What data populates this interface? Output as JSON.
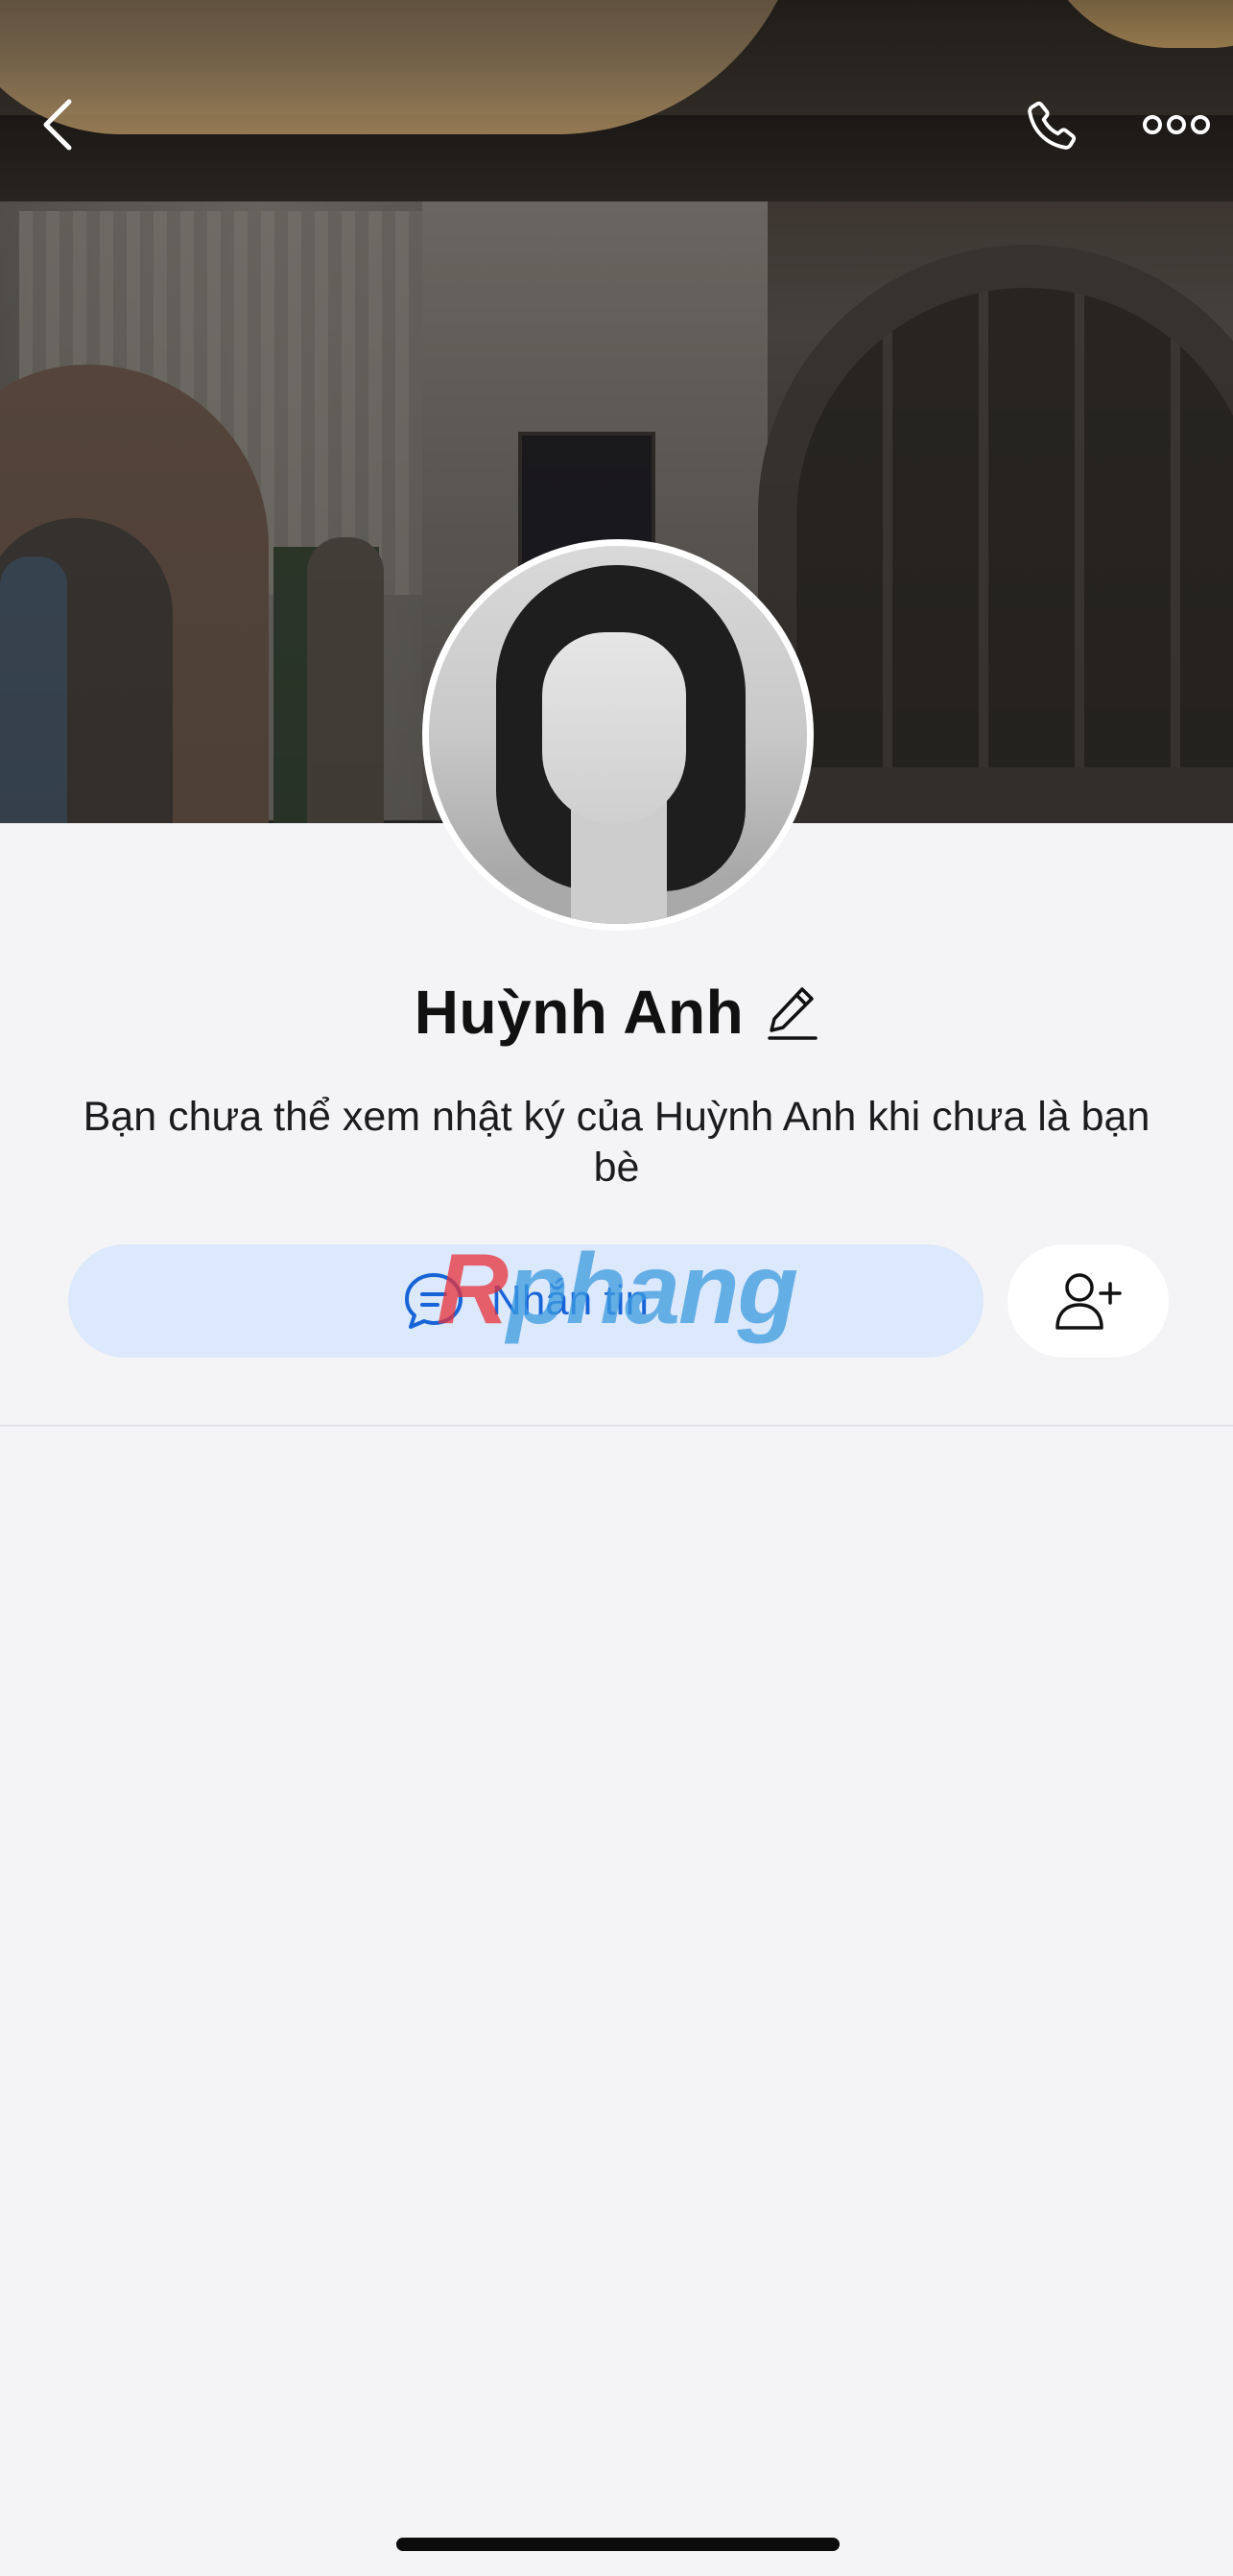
{
  "header": {
    "back_icon": "chevron-left-icon",
    "call_icon": "phone-icon",
    "more_icon": "more-horizontal-icon"
  },
  "profile": {
    "name": "Huỳnh Anh",
    "edit_icon": "pencil-icon",
    "subtitle": "Bạn chưa thể xem nhật ký của Huỳnh Anh khi chưa là bạn bè"
  },
  "actions": {
    "message_label": "Nhắn tin",
    "message_icon": "chat-bubble-icon",
    "add_friend_icon": "add-user-icon"
  },
  "watermark": {
    "prefix": "R",
    "rest": "phang"
  },
  "colors": {
    "accent": "#1764d8",
    "message_button_bg": "#dce8fb",
    "background": "#f4f4f7"
  }
}
